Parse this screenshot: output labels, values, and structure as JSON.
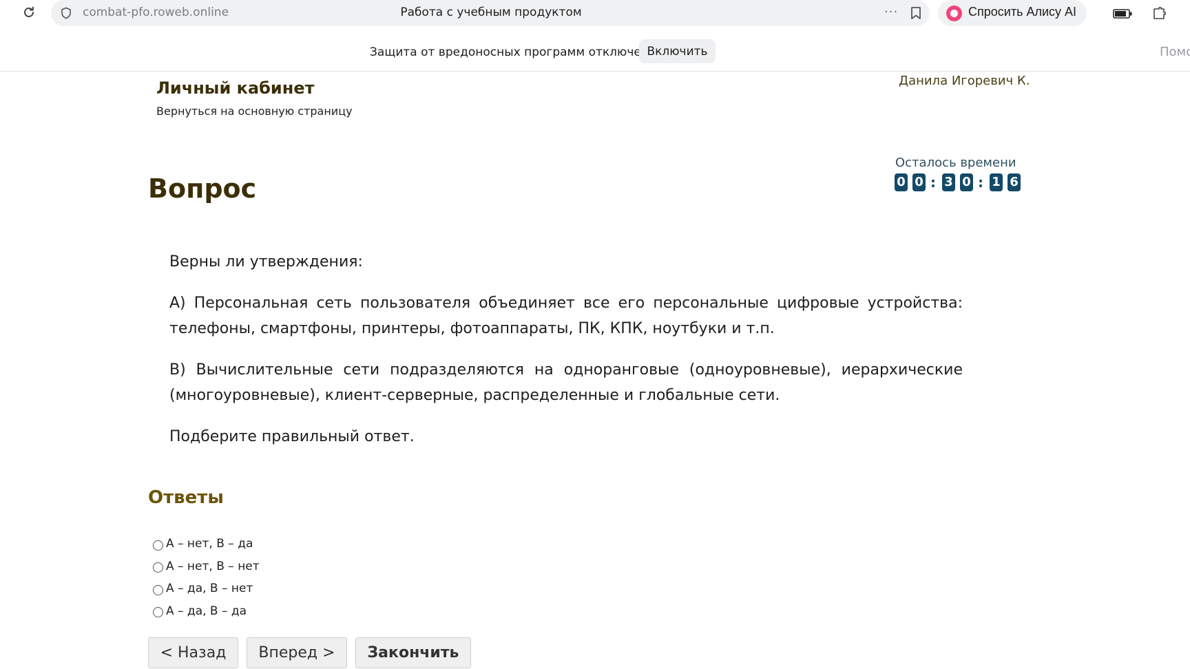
{
  "browser": {
    "url": "combat-pfo.roweb.online",
    "tab_title": "Работа с учебным продуктом",
    "more_label": "···",
    "alice_label": "Спросить Алису AI"
  },
  "infobar": {
    "message": "Защита от вредоносных программ отключена",
    "enable_label": "Включить",
    "help_label": "Помощь"
  },
  "header": {
    "cabinet_title": "Личный кабинет",
    "back_link": "Вернуться на основную страницу",
    "user_name": "Данила Игоревич К."
  },
  "timer": {
    "label": "Осталось времени",
    "digits": [
      "0",
      "0",
      "3",
      "0",
      "1",
      "6"
    ],
    "separator": ":"
  },
  "question": {
    "title": "Вопрос",
    "paragraphs": [
      "Верны ли утверждения:",
      "А) Персональная сеть пользователя объединяет все его персональные цифровые устройства: телефоны, смартфоны, принтеры, фотоаппараты, ПК, КПК, ноутбуки и т.п.",
      "В) Вычислительные сети подразделяются на одноранговые (одноуровневые), иерархические (многоуровневые), клиент-серверные, распределенные и глобальные сети.",
      "Подберите правильный ответ."
    ]
  },
  "answers": {
    "title": "Ответы",
    "options": [
      "А – нет, В – да",
      "А – нет, В – нет",
      "А – да, В – нет",
      "А – да, В – да"
    ]
  },
  "nav": {
    "back_label": "< Назад",
    "next_label": "Вперед >",
    "finish_label": "Закончить"
  }
}
